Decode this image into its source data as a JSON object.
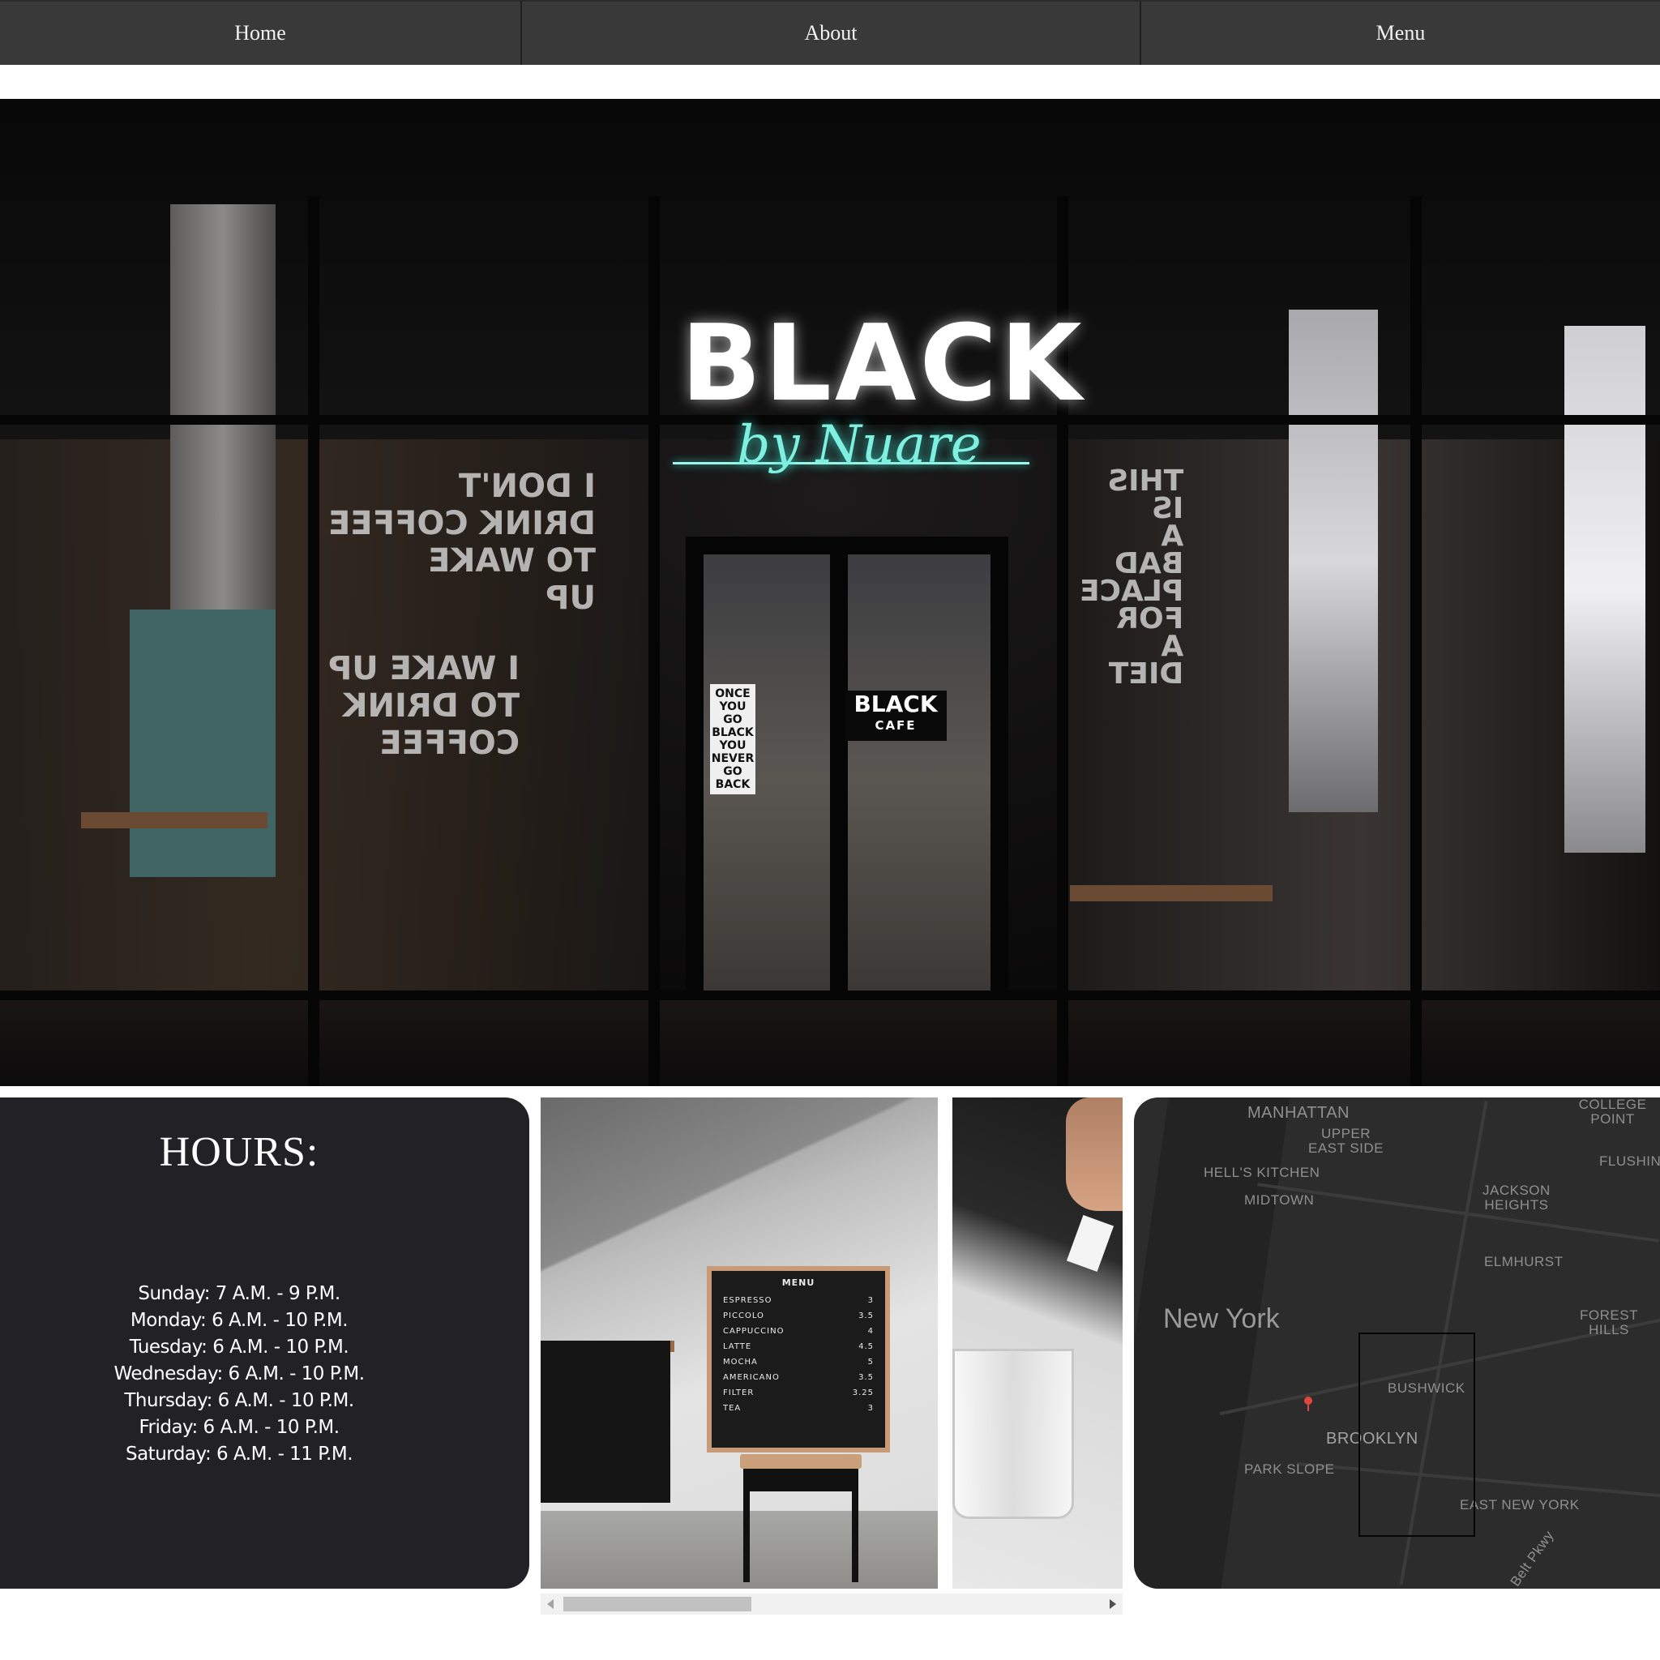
{
  "nav": {
    "items": [
      {
        "label": "Home"
      },
      {
        "label": "About"
      },
      {
        "label": "Menu"
      }
    ]
  },
  "hero": {
    "sign_main": "BLACK",
    "sign_script": "by Nuare",
    "window_left_1": "I DON'T\nDRINK COFFEE\nTO WAKE\nUP",
    "window_left_2": "I WAKE UP\nTO DRINK\nCOFFEE",
    "window_right": "THIS\nIS\nA\nBAD\nPLACE\nFOR\nA\nDIET",
    "door_note": "ONCE YOU GO BLACK YOU NEVER GO BACK",
    "door_sign_main": "BLACK",
    "door_sign_sub": "CAFE"
  },
  "hours": {
    "title": "HOURS:",
    "days": [
      "Sunday: 7 A.M. - 9 P.M.",
      "Monday: 6 A.M. - 10 P.M.",
      "Tuesday: 6 A.M. - 10 P.M.",
      "Wednesday: 6 A.M. - 10 P.M.",
      "Thursday: 6 A.M. - 10 P.M.",
      "Friday: 6 A.M. - 10 P.M.",
      "Saturday: 6 A.M. - 11 P.M."
    ]
  },
  "gallery": {
    "menu_board": {
      "title": "MENU",
      "items": [
        {
          "name": "ESPRESSO",
          "price": "3"
        },
        {
          "name": "PICCOLO",
          "price": "3.5"
        },
        {
          "name": "CAPPUCCINO",
          "price": "4"
        },
        {
          "name": "LATTE",
          "price": "4.5"
        },
        {
          "name": "MOCHA",
          "price": "5"
        },
        {
          "name": "AMERICANO",
          "price": "3.5"
        },
        {
          "name": "FILTER",
          "price": "3.25"
        },
        {
          "name": "TEA",
          "price": "3"
        }
      ]
    }
  },
  "map": {
    "labels": {
      "manhattan": "MANHATTAN",
      "upper_east_side": "UPPER\nEAST SIDE",
      "hells_kitchen": "HELL'S KITCHEN",
      "midtown": "MIDTOWN",
      "jackson_heights": "JACKSON\nHEIGHTS",
      "elmhurst": "ELMHURST",
      "flushing": "FLUSHING",
      "college_point": "COLLEGE POINT",
      "forest_hills": "FOREST HILLS",
      "new_york": "New York",
      "bushwick": "BUSHWICK",
      "brooklyn": "BROOKLYN",
      "park_slope": "PARK SLOPE",
      "east_new_york": "EAST NEW YORK",
      "belt_pkwy": "Belt Pkwy"
    },
    "pin_color": "#e0483d"
  },
  "colors": {
    "nav_bg": "#3a3939",
    "panel_bg": "#222124",
    "neon": "#7ff0e0"
  }
}
